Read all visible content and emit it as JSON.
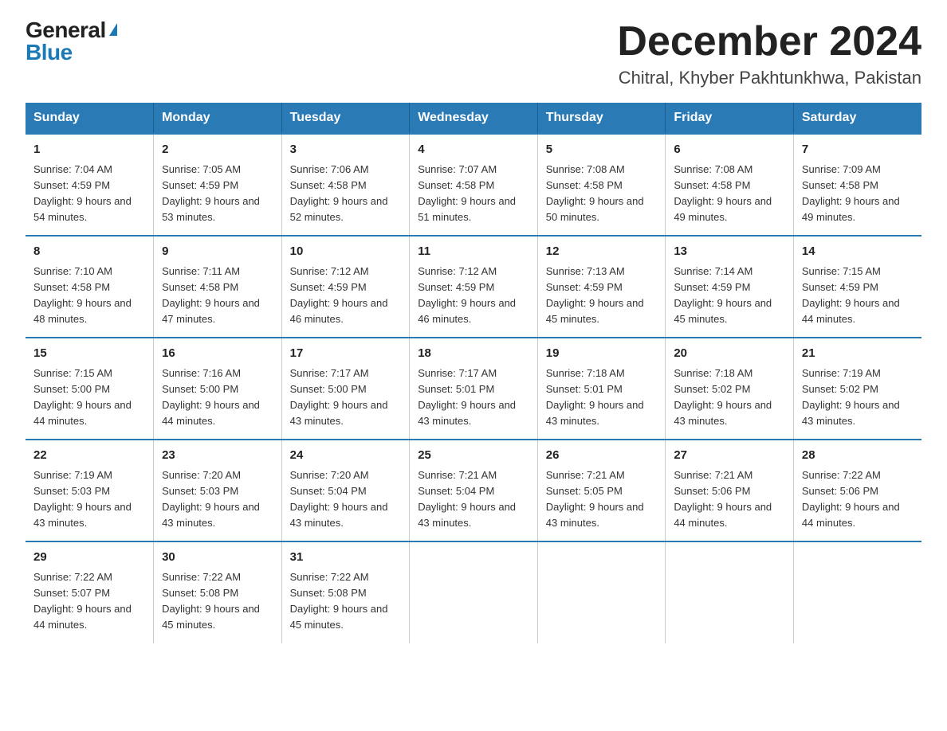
{
  "logo": {
    "general": "General",
    "blue": "Blue",
    "triangle": "▶"
  },
  "header": {
    "month_year": "December 2024",
    "location": "Chitral, Khyber Pakhtunkhwa, Pakistan"
  },
  "columns": [
    "Sunday",
    "Monday",
    "Tuesday",
    "Wednesday",
    "Thursday",
    "Friday",
    "Saturday"
  ],
  "weeks": [
    [
      {
        "day": "1",
        "sunrise": "7:04 AM",
        "sunset": "4:59 PM",
        "daylight": "9 hours and 54 minutes."
      },
      {
        "day": "2",
        "sunrise": "7:05 AM",
        "sunset": "4:59 PM",
        "daylight": "9 hours and 53 minutes."
      },
      {
        "day": "3",
        "sunrise": "7:06 AM",
        "sunset": "4:58 PM",
        "daylight": "9 hours and 52 minutes."
      },
      {
        "day": "4",
        "sunrise": "7:07 AM",
        "sunset": "4:58 PM",
        "daylight": "9 hours and 51 minutes."
      },
      {
        "day": "5",
        "sunrise": "7:08 AM",
        "sunset": "4:58 PM",
        "daylight": "9 hours and 50 minutes."
      },
      {
        "day": "6",
        "sunrise": "7:08 AM",
        "sunset": "4:58 PM",
        "daylight": "9 hours and 49 minutes."
      },
      {
        "day": "7",
        "sunrise": "7:09 AM",
        "sunset": "4:58 PM",
        "daylight": "9 hours and 49 minutes."
      }
    ],
    [
      {
        "day": "8",
        "sunrise": "7:10 AM",
        "sunset": "4:58 PM",
        "daylight": "9 hours and 48 minutes."
      },
      {
        "day": "9",
        "sunrise": "7:11 AM",
        "sunset": "4:58 PM",
        "daylight": "9 hours and 47 minutes."
      },
      {
        "day": "10",
        "sunrise": "7:12 AM",
        "sunset": "4:59 PM",
        "daylight": "9 hours and 46 minutes."
      },
      {
        "day": "11",
        "sunrise": "7:12 AM",
        "sunset": "4:59 PM",
        "daylight": "9 hours and 46 minutes."
      },
      {
        "day": "12",
        "sunrise": "7:13 AM",
        "sunset": "4:59 PM",
        "daylight": "9 hours and 45 minutes."
      },
      {
        "day": "13",
        "sunrise": "7:14 AM",
        "sunset": "4:59 PM",
        "daylight": "9 hours and 45 minutes."
      },
      {
        "day": "14",
        "sunrise": "7:15 AM",
        "sunset": "4:59 PM",
        "daylight": "9 hours and 44 minutes."
      }
    ],
    [
      {
        "day": "15",
        "sunrise": "7:15 AM",
        "sunset": "5:00 PM",
        "daylight": "9 hours and 44 minutes."
      },
      {
        "day": "16",
        "sunrise": "7:16 AM",
        "sunset": "5:00 PM",
        "daylight": "9 hours and 44 minutes."
      },
      {
        "day": "17",
        "sunrise": "7:17 AM",
        "sunset": "5:00 PM",
        "daylight": "9 hours and 43 minutes."
      },
      {
        "day": "18",
        "sunrise": "7:17 AM",
        "sunset": "5:01 PM",
        "daylight": "9 hours and 43 minutes."
      },
      {
        "day": "19",
        "sunrise": "7:18 AM",
        "sunset": "5:01 PM",
        "daylight": "9 hours and 43 minutes."
      },
      {
        "day": "20",
        "sunrise": "7:18 AM",
        "sunset": "5:02 PM",
        "daylight": "9 hours and 43 minutes."
      },
      {
        "day": "21",
        "sunrise": "7:19 AM",
        "sunset": "5:02 PM",
        "daylight": "9 hours and 43 minutes."
      }
    ],
    [
      {
        "day": "22",
        "sunrise": "7:19 AM",
        "sunset": "5:03 PM",
        "daylight": "9 hours and 43 minutes."
      },
      {
        "day": "23",
        "sunrise": "7:20 AM",
        "sunset": "5:03 PM",
        "daylight": "9 hours and 43 minutes."
      },
      {
        "day": "24",
        "sunrise": "7:20 AM",
        "sunset": "5:04 PM",
        "daylight": "9 hours and 43 minutes."
      },
      {
        "day": "25",
        "sunrise": "7:21 AM",
        "sunset": "5:04 PM",
        "daylight": "9 hours and 43 minutes."
      },
      {
        "day": "26",
        "sunrise": "7:21 AM",
        "sunset": "5:05 PM",
        "daylight": "9 hours and 43 minutes."
      },
      {
        "day": "27",
        "sunrise": "7:21 AM",
        "sunset": "5:06 PM",
        "daylight": "9 hours and 44 minutes."
      },
      {
        "day": "28",
        "sunrise": "7:22 AM",
        "sunset": "5:06 PM",
        "daylight": "9 hours and 44 minutes."
      }
    ],
    [
      {
        "day": "29",
        "sunrise": "7:22 AM",
        "sunset": "5:07 PM",
        "daylight": "9 hours and 44 minutes."
      },
      {
        "day": "30",
        "sunrise": "7:22 AM",
        "sunset": "5:08 PM",
        "daylight": "9 hours and 45 minutes."
      },
      {
        "day": "31",
        "sunrise": "7:22 AM",
        "sunset": "5:08 PM",
        "daylight": "9 hours and 45 minutes."
      },
      null,
      null,
      null,
      null
    ]
  ]
}
